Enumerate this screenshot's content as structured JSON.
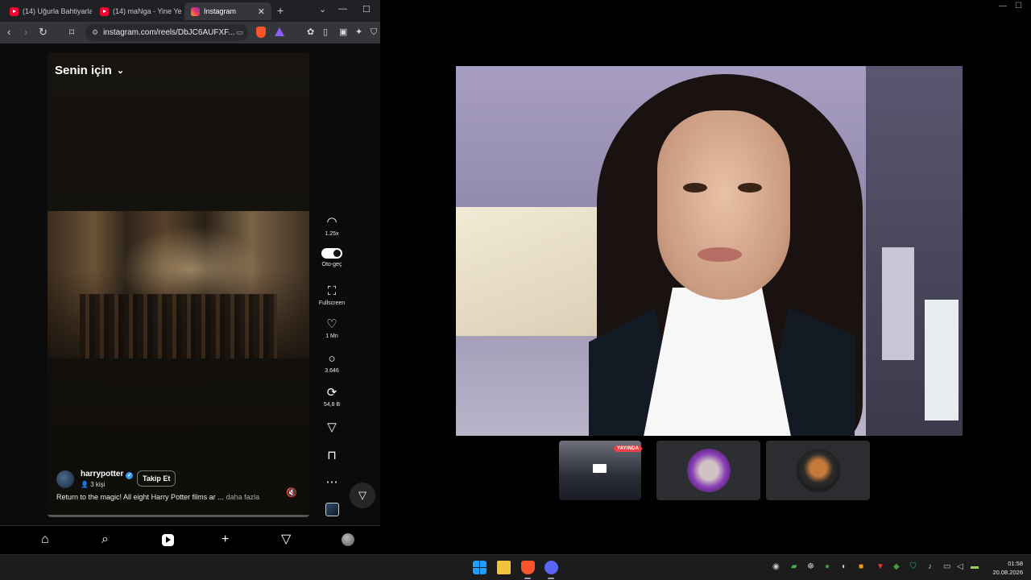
{
  "browser": {
    "tabs": [
      {
        "title": "(14) Uğurla Bahtiyarla",
        "icon": "youtube-icon"
      },
      {
        "title": "(14) maNga - Yine Yer",
        "icon": "youtube-icon"
      },
      {
        "title": "Instagram",
        "icon": "instagram-icon",
        "active": true
      }
    ],
    "url": "instagram.com/reels/DbJC6AUFXF..."
  },
  "instagram": {
    "feed_title": "Senin için",
    "actions": {
      "speed": "1.25x",
      "autoplay": "Oto-geç",
      "fullscreen": "Fullscreen",
      "likes": "1 Mn",
      "comments": "3.646",
      "reposts": "54,8 B"
    },
    "author": {
      "username": "harrypotter",
      "people": "3 kişi",
      "follow_label": "Takip Et"
    },
    "caption": "Return to the magic! All eight Harry Potter films ar ...",
    "caption_more": "daha fazla"
  },
  "stream": {
    "live_label": "YAYINDA"
  },
  "taskbar": {
    "time": "01:58",
    "date": "20.08.2026"
  },
  "colors": {
    "accent_live": "#ed4245",
    "brave": "#fb542b",
    "discord": "#5865f2",
    "windows": "#1fa0ff"
  }
}
